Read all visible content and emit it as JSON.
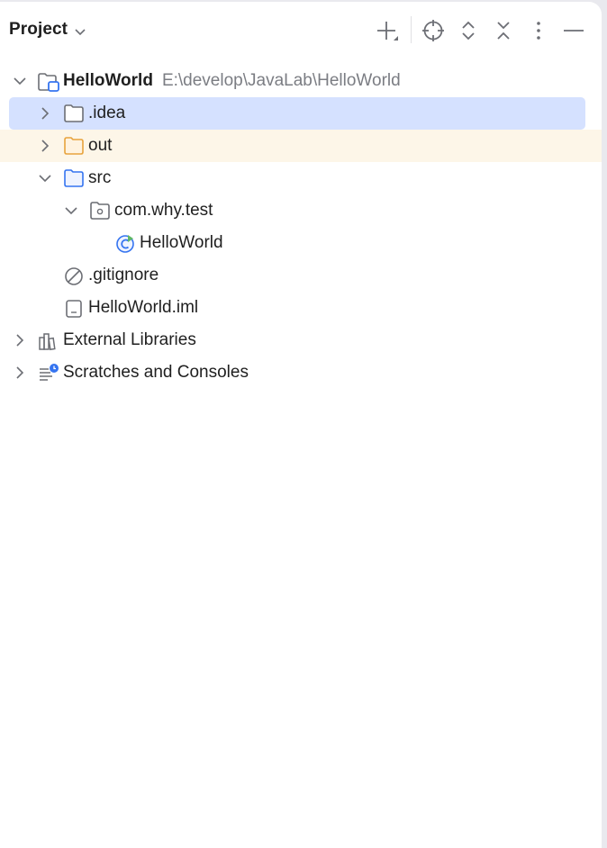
{
  "header": {
    "title": "Project"
  },
  "tree": {
    "root": {
      "name": "HelloWorld",
      "path": "E:\\develop\\JavaLab\\HelloWorld"
    },
    "idea": {
      "name": ".idea"
    },
    "out": {
      "name": "out"
    },
    "src": {
      "name": "src"
    },
    "package": {
      "name": "com.why.test"
    },
    "main_class": {
      "name": "HelloWorld"
    },
    "gitignore": {
      "name": ".gitignore"
    },
    "iml": {
      "name": "HelloWorld.iml"
    },
    "external_libraries": {
      "name": "External Libraries"
    },
    "scratches": {
      "name": "Scratches and Consoles"
    }
  },
  "colors": {
    "selection": "#d5e1ff",
    "excluded_row": "#fdf6e8",
    "folder_blue": "#3574f0",
    "folder_orange": "#e8a33d",
    "path_gray": "#7b7d83"
  }
}
